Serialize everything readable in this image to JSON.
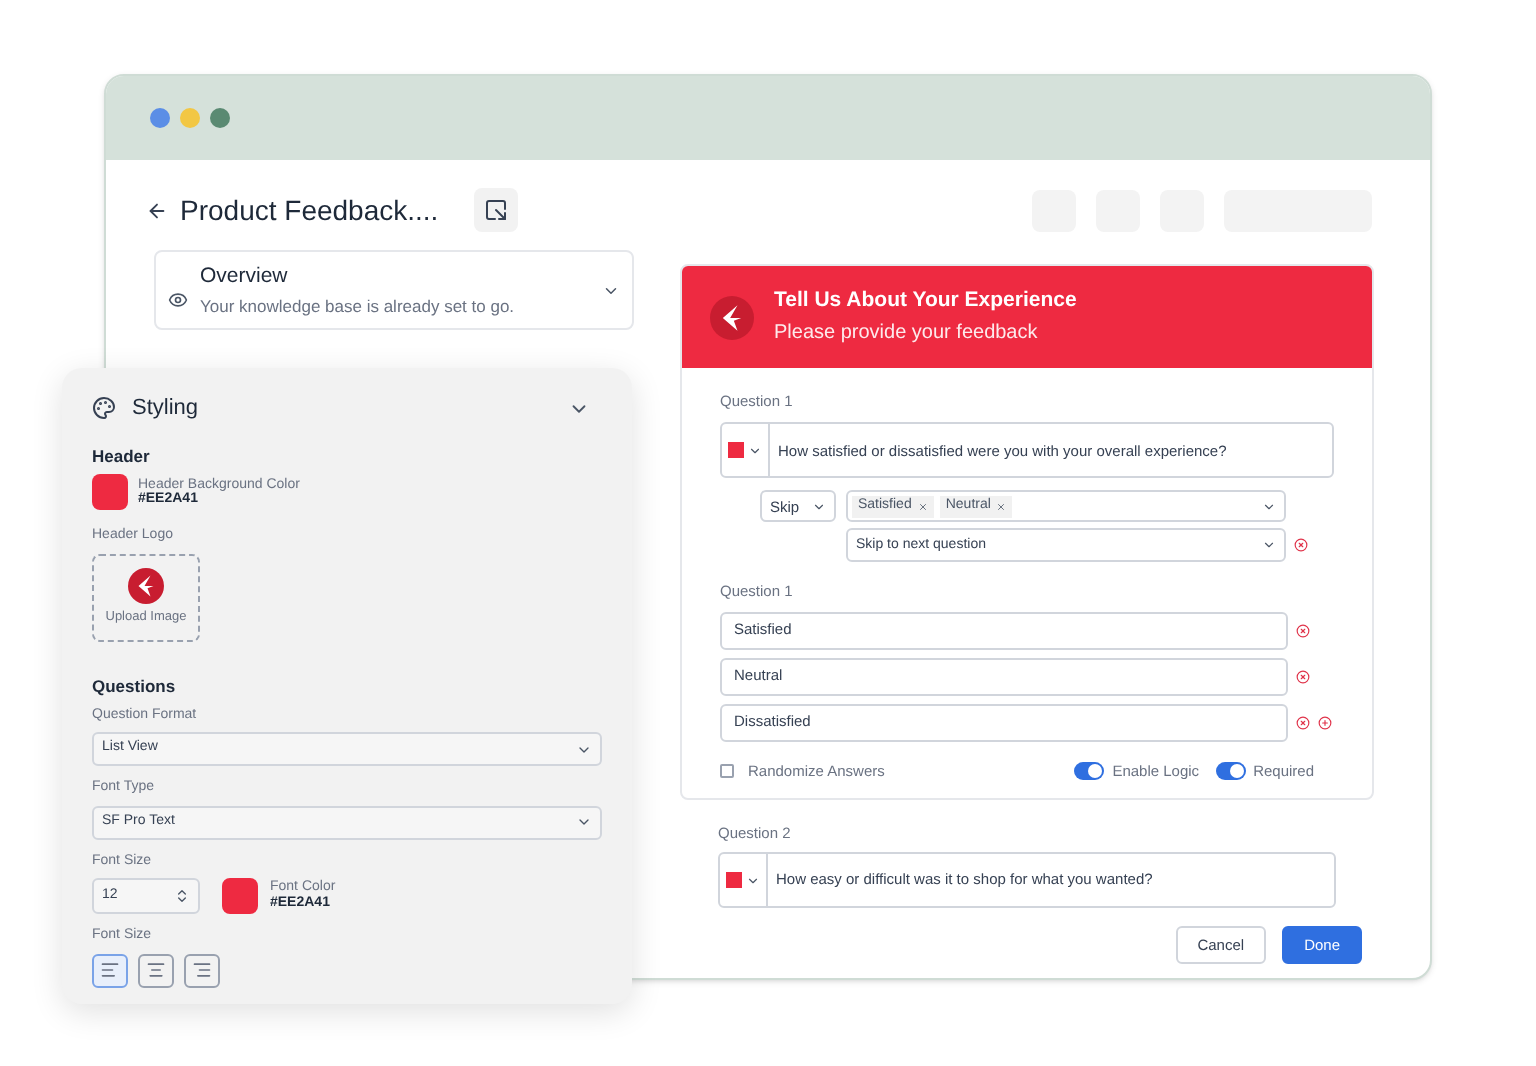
{
  "window": {
    "title": "Product Feedback....",
    "dots": [
      {
        "color": "#5b8ee6"
      },
      {
        "color": "#f2c744"
      },
      {
        "color": "#5a8a72"
      }
    ]
  },
  "overview": {
    "title": "Overview",
    "description": "Your knowledge base is already set to go."
  },
  "form": {
    "title": "Tell Us About Your Experience",
    "subtitle": "Please provide your feedback",
    "question_1": {
      "label": "Question 1",
      "text": "How satisfied or dissatisfied were you with your overall experience?"
    },
    "logic": {
      "action": "Skip",
      "tags": [
        "Satisfied",
        "Neutral"
      ],
      "target": "Skip to next question"
    },
    "answers": {
      "label": "Question 1",
      "options": [
        "Satisfied",
        "Neutral",
        "Dissatisfied"
      ]
    },
    "randomize": {
      "label": "Randomize Answers",
      "checked": false
    },
    "toggles": [
      {
        "label": "Enable Logic",
        "on": true
      },
      {
        "label": "Required",
        "on": true
      }
    ],
    "question_2": {
      "label": "Question 2",
      "text": "How easy or difficult was it to shop for what you wanted?"
    },
    "buttons": [
      {
        "label": "Cancel",
        "kind": "secondary"
      },
      {
        "label": "Done",
        "kind": "primary"
      }
    ]
  },
  "styling": {
    "title": "Styling",
    "header_section": "Header",
    "header_color": {
      "label": "Header Background Color",
      "value": "#EE2A41"
    },
    "logo_label": "Header Logo",
    "upload_label": "Upload Image",
    "questions_section": "Questions",
    "question_format": {
      "label": "Question Format",
      "value": "List View"
    },
    "font_type": {
      "label": "Font Type",
      "value": "SF Pro Text"
    },
    "font_size": {
      "label": "Font Size",
      "value": "12"
    },
    "font_color": {
      "label": "Font Color",
      "value": "#EE2A41"
    },
    "alignment_label": "Font Size",
    "alignments": [
      {
        "kind": "left",
        "selected": true
      },
      {
        "kind": "center",
        "selected": false
      },
      {
        "kind": "right",
        "selected": false
      }
    ]
  }
}
